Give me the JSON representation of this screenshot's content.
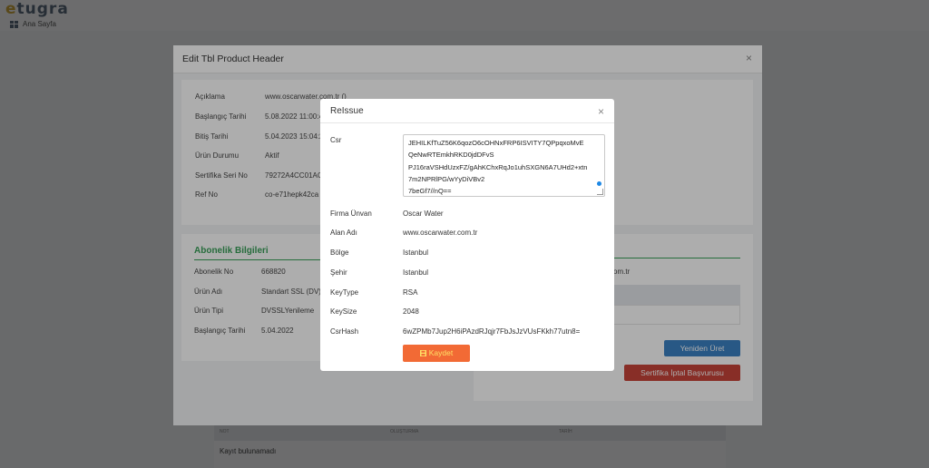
{
  "app": {
    "logo_first": "e",
    "logo_rest": "tugra",
    "breadcrumb": "Ana Sayfa"
  },
  "background_table": {
    "columns": [
      "NOT",
      "OLUŞTURMA",
      "TARİH"
    ],
    "empty_text": "Kayıt bulunamadı"
  },
  "edit_modal": {
    "title": "Edit Tbl Product Header",
    "close": "×",
    "product_rows": [
      {
        "label": "Açıklama",
        "value": "www.oscarwater.com.tr ()"
      },
      {
        "label": "Başlangıç Tarihi",
        "value": "5.08.2022 11:00:4"
      },
      {
        "label": "Bitiş Tarihi",
        "value": "5.04.2023 15:04:2"
      },
      {
        "label": "Ürün Durumu",
        "value": "Aktif"
      },
      {
        "label": "Sertifika Seri No",
        "value": "79272A4CC01ACB"
      },
      {
        "label": "Ref No",
        "value": "co-e71hepk42ca"
      }
    ],
    "subscription": {
      "title": "Abonelik Bilgileri",
      "rows": [
        {
          "label": "Abonelik No",
          "value": "668820"
        },
        {
          "label": "Ürün Adı",
          "value": "Standart SSL (DV)"
        },
        {
          "label": "Ürün Tipi",
          "value": "DVSSLYenileme"
        },
        {
          "label": "Başlangıç Tarihi",
          "value": "5.04.2022"
        }
      ]
    },
    "right_domain_fragment": "om.tr",
    "regenerate_button": "Yeniden Üret",
    "cancel_request_button": "Sertifika İptal Başvurusu"
  },
  "reissue_modal": {
    "title": "ReIssue",
    "close": "×",
    "csr_label": "Csr",
    "csr_lines": [
      "JEHILKfTuZ56K6qozO6cOHNxFRP6ISVITY7QPpqxoMvE",
      "QeNwRTEmkhRKD0jdDFvS",
      "PJ16raVSHdUzxFZ/gAhKChxRqJo1uhSXGN6A7UHd2+xtn",
      "7m2NPRlPG/wYyDiVBv2",
      "7beGf7//nQ=="
    ],
    "fields": [
      {
        "label": "Firma Ünvan",
        "value": "Oscar Water"
      },
      {
        "label": "Alan Adı",
        "value": "www.oscarwater.com.tr"
      },
      {
        "label": "Bölge",
        "value": "Istanbul"
      },
      {
        "label": "Şehir",
        "value": "Istanbul"
      },
      {
        "label": "KeyType",
        "value": "RSA"
      },
      {
        "label": "KeySize",
        "value": "2048"
      },
      {
        "label": "CsrHash",
        "value": "6wZPMb7Jup2H6iPAzdRJqjr7FbJsJzVUsFKkh77utn8="
      }
    ],
    "save_button": "Kaydet"
  },
  "colors": {
    "accent_green": "#3aa15a",
    "save_orange": "#f26a35",
    "blue_button": "#3b82c4",
    "red_button": "#c9443a"
  }
}
